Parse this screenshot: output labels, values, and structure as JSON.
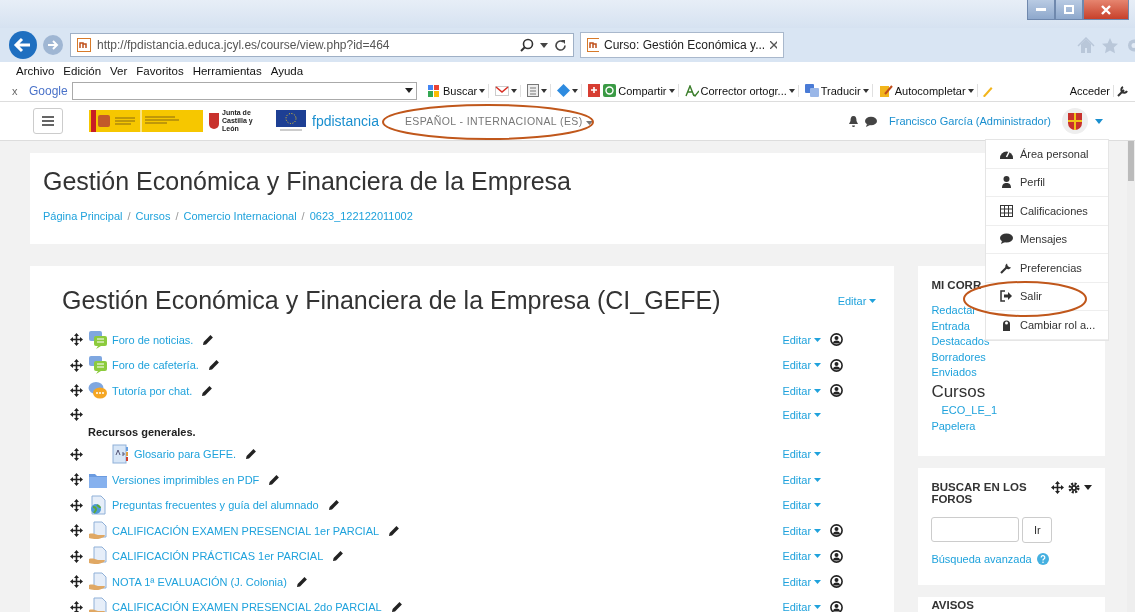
{
  "browser": {
    "address": "http://fpdistancia.educa.jcyl.es/course/view.php?id=464",
    "tab": {
      "title": "Curso: Gestión Económica y...",
      "selected": true
    }
  },
  "menu_bar": [
    "Archivo",
    "Edición",
    "Ver",
    "Favoritos",
    "Herramientas",
    "Ayuda"
  ],
  "google_toolbar": {
    "close": "x",
    "brand": "Google",
    "tools": [
      {
        "kind": "search",
        "label": "Buscar"
      },
      {
        "kind": "mail"
      },
      {
        "kind": "doc"
      },
      {
        "kind": "plus"
      },
      {
        "kind": "share",
        "label": "Compartir"
      },
      {
        "kind": "spell",
        "label": "Corrector ortogr..."
      },
      {
        "kind": "translate",
        "label": "Traducir"
      },
      {
        "kind": "autofill",
        "label": "Autocompletar"
      }
    ],
    "login": "Acceder"
  },
  "navbar": {
    "junta": "Junta de Castilla y León",
    "site_name": "fpdistancia",
    "language": "ESPAÑOL - INTERNACIONAL (ES)",
    "user": "Francisco García (Administrador)"
  },
  "user_menu": {
    "expanded": true,
    "items": [
      {
        "kind": "dashboard",
        "label": "Área personal"
      },
      {
        "kind": "profile",
        "label": "Perfil"
      },
      {
        "kind": "grades",
        "label": "Calificaciones"
      },
      {
        "kind": "messages",
        "label": "Mensajes"
      },
      {
        "kind": "preferences",
        "label": "Preferencias"
      },
      {
        "kind": "logout",
        "label": "Salir"
      },
      {
        "kind": "switchrole",
        "label": "Cambiar rol a..."
      }
    ]
  },
  "header": {
    "title": "Gestión Económica y Financiera de la Empresa",
    "breadcrumb": [
      "Página Principal",
      "Cursos",
      "Comercio Internacional",
      "0623_122122011002"
    ],
    "separators": [
      "/",
      "/",
      "/"
    ]
  },
  "course": {
    "title": "Gestión Económica y Financiera de la Empresa (CI_GEFE)",
    "edit": "Editar",
    "activities": [
      {
        "kind": "forum",
        "name": "Foro de noticias.",
        "edit": "Editar",
        "group_icon": true
      },
      {
        "kind": "forum",
        "name": "Foro de cafetería.",
        "edit": "Editar",
        "group_icon": true
      },
      {
        "kind": "chat",
        "name": "Tutoría por chat.",
        "edit": "Editar",
        "group_icon": true
      },
      {
        "kind": "label",
        "name": "Recursos generales.",
        "edit": "Editar",
        "group_icon": false,
        "children": [
          {
            "kind": "glossary",
            "name": "Glosario para GEFE.",
            "edit": "Editar",
            "group_icon": false
          }
        ]
      },
      {
        "kind": "folder",
        "name": "Versiones imprimibles en PDF",
        "edit": "Editar",
        "group_icon": false
      },
      {
        "kind": "url",
        "name": "Preguntas frecuentes y guía del alumnado",
        "edit": "Editar",
        "group_icon": false
      },
      {
        "kind": "assign",
        "name": "CALIFICACIÓN EXAMEN PRESENCIAL 1er PARCIAL",
        "edit": "Editar",
        "group_icon": true
      },
      {
        "kind": "assign",
        "name": "CALIFICACIÓN PRÁCTICAS 1er PARCIAL",
        "edit": "Editar",
        "group_icon": true
      },
      {
        "kind": "assign",
        "name": "NOTA 1ª EVALUACIÓN (J. Colonia)",
        "edit": "Editar",
        "group_icon": true
      },
      {
        "kind": "assign",
        "name": "CALIFICACIÓN EXAMEN PRESENCIAL 2do PARCIAL",
        "edit": "Editar",
        "group_icon": true
      }
    ]
  },
  "mail_block": {
    "title": "MI CORR",
    "links": [
      "Redactar",
      "Entrada",
      "Destacados",
      "Borradores",
      "Enviados"
    ],
    "courses_heading": "Cursos",
    "courses": [
      "ECO_LE_1"
    ],
    "trash": "Papelera"
  },
  "search_block": {
    "title": "BUSCAR EN LOS FOROS",
    "button": "Ir",
    "advanced": "Búsqueda avanzada"
  },
  "news_block": {
    "title": "AVISOS"
  }
}
